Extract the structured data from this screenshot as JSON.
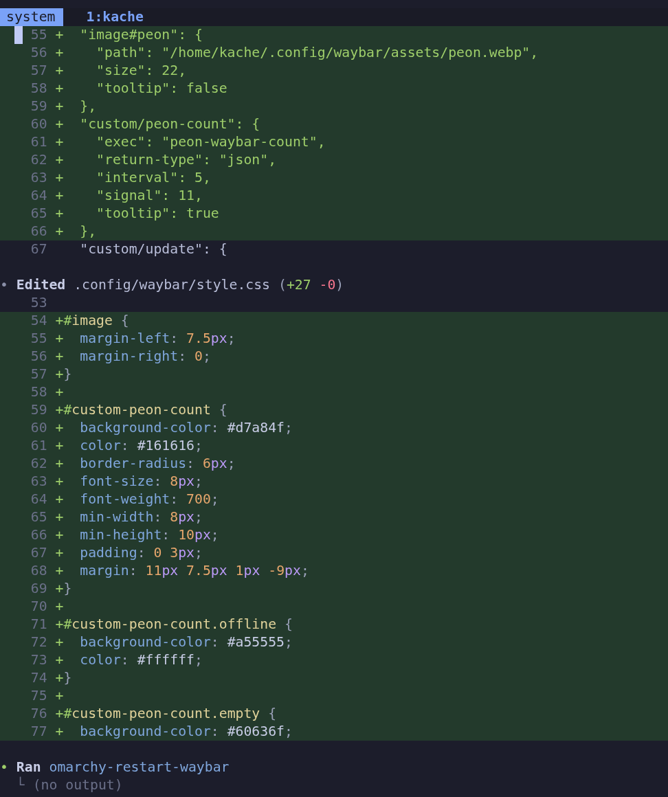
{
  "tabs": [
    {
      "label": "system",
      "selected": true
    },
    {
      "label": "1:kache",
      "selected": false
    }
  ],
  "blocks": [
    {
      "kind": "diff",
      "lines": [
        {
          "number": "55",
          "kind": "add",
          "sign": "+",
          "cursor": true,
          "tokens": [
            {
              "kind": "str",
              "text": "  \"image#peon\": {"
            }
          ]
        },
        {
          "number": "56",
          "kind": "add",
          "sign": "+",
          "cursor": false,
          "tokens": [
            {
              "kind": "str",
              "text": "    \"path\": \"/home/kache/.config/waybar/assets/peon.webp\","
            }
          ]
        },
        {
          "number": "57",
          "kind": "add",
          "sign": "+",
          "cursor": false,
          "tokens": [
            {
              "kind": "str",
              "text": "    \"size\": 22,"
            }
          ]
        },
        {
          "number": "58",
          "kind": "add",
          "sign": "+",
          "cursor": false,
          "tokens": [
            {
              "kind": "str",
              "text": "    \"tooltip\": false"
            }
          ]
        },
        {
          "number": "59",
          "kind": "add",
          "sign": "+",
          "cursor": false,
          "tokens": [
            {
              "kind": "str",
              "text": "  },"
            }
          ]
        },
        {
          "number": "60",
          "kind": "add",
          "sign": "+",
          "cursor": false,
          "tokens": [
            {
              "kind": "str",
              "text": "  \"custom/peon-count\": {"
            }
          ]
        },
        {
          "number": "61",
          "kind": "add",
          "sign": "+",
          "cursor": false,
          "tokens": [
            {
              "kind": "str",
              "text": "    \"exec\": \"peon-waybar-count\","
            }
          ]
        },
        {
          "number": "62",
          "kind": "add",
          "sign": "+",
          "cursor": false,
          "tokens": [
            {
              "kind": "str",
              "text": "    \"return-type\": \"json\","
            }
          ]
        },
        {
          "number": "63",
          "kind": "add",
          "sign": "+",
          "cursor": false,
          "tokens": [
            {
              "kind": "str",
              "text": "    \"interval\": 5,"
            }
          ]
        },
        {
          "number": "64",
          "kind": "add",
          "sign": "+",
          "cursor": false,
          "tokens": [
            {
              "kind": "str",
              "text": "    \"signal\": 11,"
            }
          ]
        },
        {
          "number": "65",
          "kind": "add",
          "sign": "+",
          "cursor": false,
          "tokens": [
            {
              "kind": "str",
              "text": "    \"tooltip\": true"
            }
          ]
        },
        {
          "number": "66",
          "kind": "add",
          "sign": "+",
          "cursor": false,
          "tokens": [
            {
              "kind": "str",
              "text": "  },"
            }
          ]
        },
        {
          "number": "67",
          "kind": "context",
          "cursor": false,
          "tokens": [
            {
              "kind": "plain",
              "text": "  \"custom/update\": {"
            }
          ]
        }
      ]
    },
    {
      "kind": "event",
      "color": "#8a8fa8",
      "bullet": "•",
      "verb": "Edited",
      "target": ".config/waybar/style.css",
      "stats_open": "(",
      "added": "+27",
      "removed": "-0",
      "stats_close": ")",
      "lines": [
        {
          "number": "53",
          "kind": "context",
          "cursor": false
        },
        {
          "number": "54",
          "kind": "add",
          "sign": "+",
          "cursor": false,
          "tokens": [
            {
              "kind": "hash",
              "text": "#"
            },
            {
              "kind": "sel",
              "text": "image"
            },
            {
              "kind": "punct",
              "text": " {"
            }
          ]
        },
        {
          "number": "55",
          "kind": "add",
          "sign": "+",
          "cursor": false,
          "tokens": [
            {
              "kind": "prop",
              "text": "  margin-left"
            },
            {
              "kind": "punct",
              "text": ": "
            },
            {
              "kind": "num",
              "text": "7.5"
            },
            {
              "kind": "unit",
              "text": "px"
            },
            {
              "kind": "punct",
              "text": ";"
            }
          ]
        },
        {
          "number": "56",
          "kind": "add",
          "sign": "+",
          "cursor": false,
          "tokens": [
            {
              "kind": "prop",
              "text": "  margin-right"
            },
            {
              "kind": "punct",
              "text": ": "
            },
            {
              "kind": "num",
              "text": "0"
            },
            {
              "kind": "punct",
              "text": ";"
            }
          ]
        },
        {
          "number": "57",
          "kind": "add",
          "sign": "+",
          "cursor": false,
          "tokens": [
            {
              "kind": "punct",
              "text": "}"
            }
          ]
        },
        {
          "number": "58",
          "kind": "add",
          "sign": "+",
          "cursor": false
        },
        {
          "number": "59",
          "kind": "add",
          "sign": "+",
          "cursor": false,
          "tokens": [
            {
              "kind": "hash",
              "text": "#"
            },
            {
              "kind": "sel",
              "text": "custom-peon-count"
            },
            {
              "kind": "punct",
              "text": " {"
            }
          ]
        },
        {
          "number": "60",
          "kind": "add",
          "sign": "+",
          "cursor": false,
          "tokens": [
            {
              "kind": "prop",
              "text": "  background-color"
            },
            {
              "kind": "punct",
              "text": ": "
            },
            {
              "kind": "val",
              "text": "#d7a84f"
            },
            {
              "kind": "punct",
              "text": ";"
            }
          ]
        },
        {
          "number": "61",
          "kind": "add",
          "sign": "+",
          "cursor": false,
          "tokens": [
            {
              "kind": "prop",
              "text": "  color"
            },
            {
              "kind": "punct",
              "text": ": "
            },
            {
              "kind": "val",
              "text": "#161616"
            },
            {
              "kind": "punct",
              "text": ";"
            }
          ]
        },
        {
          "number": "62",
          "kind": "add",
          "sign": "+",
          "cursor": false,
          "tokens": [
            {
              "kind": "prop",
              "text": "  border-radius"
            },
            {
              "kind": "punct",
              "text": ": "
            },
            {
              "kind": "num",
              "text": "6"
            },
            {
              "kind": "unit",
              "text": "px"
            },
            {
              "kind": "punct",
              "text": ";"
            }
          ]
        },
        {
          "number": "63",
          "kind": "add",
          "sign": "+",
          "cursor": false,
          "tokens": [
            {
              "kind": "prop",
              "text": "  font-size"
            },
            {
              "kind": "punct",
              "text": ": "
            },
            {
              "kind": "num",
              "text": "8"
            },
            {
              "kind": "unit",
              "text": "px"
            },
            {
              "kind": "punct",
              "text": ";"
            }
          ]
        },
        {
          "number": "64",
          "kind": "add",
          "sign": "+",
          "cursor": false,
          "tokens": [
            {
              "kind": "prop",
              "text": "  font-weight"
            },
            {
              "kind": "punct",
              "text": ": "
            },
            {
              "kind": "num",
              "text": "700"
            },
            {
              "kind": "punct",
              "text": ";"
            }
          ]
        },
        {
          "number": "65",
          "kind": "add",
          "sign": "+",
          "cursor": false,
          "tokens": [
            {
              "kind": "prop",
              "text": "  min-width"
            },
            {
              "kind": "punct",
              "text": ": "
            },
            {
              "kind": "num",
              "text": "8"
            },
            {
              "kind": "unit",
              "text": "px"
            },
            {
              "kind": "punct",
              "text": ";"
            }
          ]
        },
        {
          "number": "66",
          "kind": "add",
          "sign": "+",
          "cursor": false,
          "tokens": [
            {
              "kind": "prop",
              "text": "  min-height"
            },
            {
              "kind": "punct",
              "text": ": "
            },
            {
              "kind": "num",
              "text": "10"
            },
            {
              "kind": "unit",
              "text": "px"
            },
            {
              "kind": "punct",
              "text": ";"
            }
          ]
        },
        {
          "number": "67",
          "kind": "add",
          "sign": "+",
          "cursor": false,
          "tokens": [
            {
              "kind": "prop",
              "text": "  padding"
            },
            {
              "kind": "punct",
              "text": ": "
            },
            {
              "kind": "num",
              "text": "0"
            },
            {
              "kind": "num",
              "text": " 3"
            },
            {
              "kind": "unit",
              "text": "px"
            },
            {
              "kind": "punct",
              "text": ";"
            }
          ]
        },
        {
          "number": "68",
          "kind": "add",
          "sign": "+",
          "cursor": false,
          "tokens": [
            {
              "kind": "prop",
              "text": "  margin"
            },
            {
              "kind": "punct",
              "text": ": "
            },
            {
              "kind": "num",
              "text": "11"
            },
            {
              "kind": "unit",
              "text": "px"
            },
            {
              "kind": "num",
              "text": " 7.5"
            },
            {
              "kind": "unit",
              "text": "px"
            },
            {
              "kind": "num",
              "text": " 1"
            },
            {
              "kind": "unit",
              "text": "px"
            },
            {
              "kind": "num",
              "text": " -9"
            },
            {
              "kind": "unit",
              "text": "px"
            },
            {
              "kind": "punct",
              "text": ";"
            }
          ]
        },
        {
          "number": "69",
          "kind": "add",
          "sign": "+",
          "cursor": false,
          "tokens": [
            {
              "kind": "punct",
              "text": "}"
            }
          ]
        },
        {
          "number": "70",
          "kind": "add",
          "sign": "+",
          "cursor": false
        },
        {
          "number": "71",
          "kind": "add",
          "sign": "+",
          "cursor": false,
          "tokens": [
            {
              "kind": "hash",
              "text": "#"
            },
            {
              "kind": "sel",
              "text": "custom-peon-count.offline"
            },
            {
              "kind": "punct",
              "text": " {"
            }
          ]
        },
        {
          "number": "72",
          "kind": "add",
          "sign": "+",
          "cursor": false,
          "tokens": [
            {
              "kind": "prop",
              "text": "  background-color"
            },
            {
              "kind": "punct",
              "text": ": "
            },
            {
              "kind": "val",
              "text": "#a55555"
            },
            {
              "kind": "punct",
              "text": ";"
            }
          ]
        },
        {
          "number": "73",
          "kind": "add",
          "sign": "+",
          "cursor": false,
          "tokens": [
            {
              "kind": "prop",
              "text": "  color"
            },
            {
              "kind": "punct",
              "text": ": "
            },
            {
              "kind": "val",
              "text": "#ffffff"
            },
            {
              "kind": "punct",
              "text": ";"
            }
          ]
        },
        {
          "number": "74",
          "kind": "add",
          "sign": "+",
          "cursor": false,
          "tokens": [
            {
              "kind": "punct",
              "text": "}"
            }
          ]
        },
        {
          "number": "75",
          "kind": "add",
          "sign": "+",
          "cursor": false
        },
        {
          "number": "76",
          "kind": "add",
          "sign": "+",
          "cursor": false,
          "tokens": [
            {
              "kind": "hash",
              "text": "#"
            },
            {
              "kind": "sel",
              "text": "custom-peon-count.empty"
            },
            {
              "kind": "punct",
              "text": " {"
            }
          ]
        },
        {
          "number": "77",
          "kind": "add",
          "sign": "+",
          "cursor": false,
          "tokens": [
            {
              "kind": "prop",
              "text": "  background-color"
            },
            {
              "kind": "punct",
              "text": ": "
            },
            {
              "kind": "val",
              "text": "#60636f"
            },
            {
              "kind": "punct",
              "text": ";"
            }
          ]
        }
      ]
    },
    {
      "kind": "event",
      "color": "#9ece6a",
      "bullet": "•",
      "verb": "Ran",
      "target": "omarchy-restart-waybar",
      "output": "└ (no output)"
    }
  ]
}
